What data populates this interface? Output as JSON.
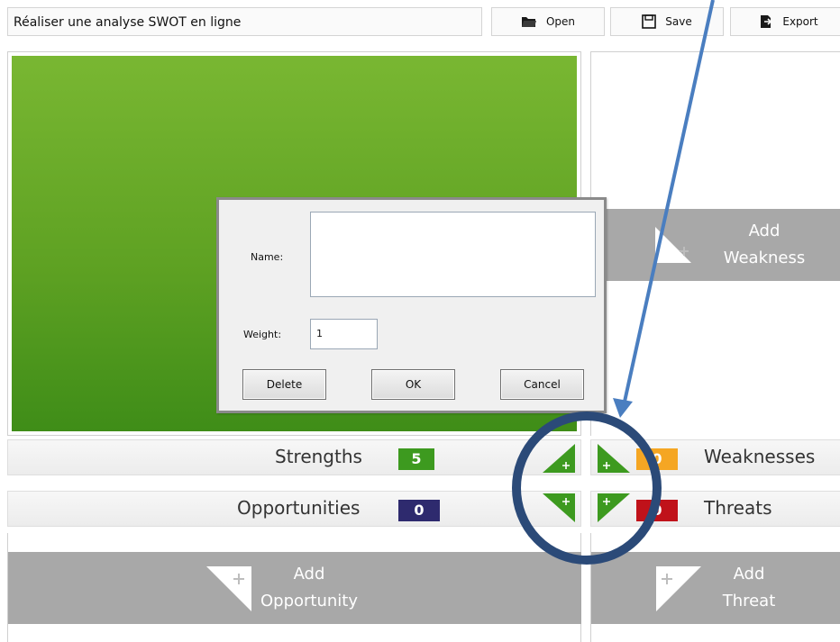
{
  "title": "Réaliser une analyse SWOT en ligne",
  "toolbar": {
    "open_label": "Open",
    "save_label": "Save",
    "export_label": "Export"
  },
  "weakness_panel": {
    "add_line1": "Add",
    "add_line2": "Weakness"
  },
  "opportunity_panel": {
    "add_line1": "Add",
    "add_line2": "Opportunity"
  },
  "threat_panel": {
    "add_line1": "Add",
    "add_line2": "Threat"
  },
  "bars": {
    "strengths": {
      "label": "Strengths",
      "count": "5",
      "color": "#3d9a1f"
    },
    "weaknesses": {
      "label": "Weaknesses",
      "count": "0",
      "color": "#f5a623"
    },
    "opportunities": {
      "label": "Opportunities",
      "count": "0",
      "color": "#2e2a6e"
    },
    "threats": {
      "label": "Threats",
      "count": "0",
      "color": "#c0121a"
    }
  },
  "dialog": {
    "name_label": "Name:",
    "name_value": "",
    "weight_label": "Weight:",
    "weight_value": "1",
    "delete_label": "Delete",
    "ok_label": "OK",
    "cancel_label": "Cancel"
  },
  "colors": {
    "green": "#5fa223",
    "add_gray": "#a8a8a8",
    "arrow": "#4a7ec0",
    "circle": "#2b4a78"
  },
  "icons": [
    "folder-icon",
    "floppy-disk-icon",
    "export-icon",
    "add-triangle-icon",
    "plus-arrow-icon"
  ]
}
